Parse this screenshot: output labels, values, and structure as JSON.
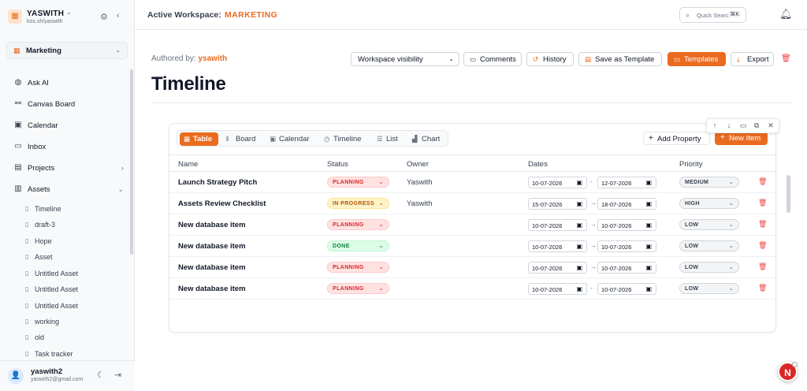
{
  "sidebar": {
    "workspace_name": "YASWITH",
    "workspace_slug": "kos.sh/yaswith",
    "selected_workspace": "Marketing",
    "nav": [
      {
        "label": "Ask AI",
        "icon": "globe-icon"
      },
      {
        "label": "Canvas Board",
        "icon": "canvas-icon"
      },
      {
        "label": "Calendar",
        "icon": "calendar-icon"
      },
      {
        "label": "Inbox",
        "icon": "inbox-icon"
      },
      {
        "label": "Projects",
        "icon": "folder-icon"
      },
      {
        "label": "Assets",
        "icon": "book-icon"
      }
    ],
    "assets": [
      "Timeline",
      "draft-3",
      "Hope",
      "Asset",
      "Untitled Asset",
      "Untitled Asset",
      "Untitled Asset",
      "working",
      "old",
      "Task tracker"
    ],
    "user": {
      "name": "yaswith2",
      "email": "yaswith2@gmail.com"
    }
  },
  "topbar": {
    "label": "Active Workspace:",
    "workspace": "MARKETING",
    "search_placeholder": "Quick Search...",
    "search_shortcut": "⌘K"
  },
  "page": {
    "authored_label": "Authored by:",
    "author": "ysawith",
    "visibility": "Workspace visibility",
    "actions": {
      "comments": "Comments",
      "history": "History",
      "save_template": "Save as Template",
      "templates": "Templates",
      "export": "Export"
    },
    "title": "Timeline"
  },
  "database": {
    "views": [
      "Table",
      "Board",
      "Calendar",
      "Timeline",
      "List",
      "Chart"
    ],
    "active_view": "Table",
    "add_property": "Add Property",
    "new_item": "New Item",
    "columns": [
      "Name",
      "Status",
      "Owner",
      "Dates",
      "Priority"
    ],
    "rows": [
      {
        "name": "Launch Strategy Pitch",
        "status": "PLANNING",
        "owner": "Yaswith",
        "start": "10-07-2026",
        "end": "12-07-2026",
        "priority": "MEDIUM"
      },
      {
        "name": "Assets Review Checklist",
        "status": "IN PROGRESS",
        "owner": "Yaswith",
        "start": "15-07-2026",
        "end": "18-07-2026",
        "priority": "HIGH"
      },
      {
        "name": "New database item",
        "status": "PLANNING",
        "owner": "",
        "start": "10-07-2026",
        "end": "10-07-2026",
        "priority": "LOW"
      },
      {
        "name": "New database item",
        "status": "DONE",
        "owner": "",
        "start": "10-07-2026",
        "end": "10-07-2026",
        "priority": "LOW"
      },
      {
        "name": "New database item",
        "status": "PLANNING",
        "owner": "",
        "start": "10-07-2026",
        "end": "10-07-2026",
        "priority": "LOW"
      },
      {
        "name": "New database item",
        "status": "PLANNING",
        "owner": "",
        "start": "10-07-2026",
        "end": "10-07-2026",
        "priority": "LOW"
      }
    ]
  },
  "colors": {
    "accent": "#ea6b1f",
    "planning": "#dc2626",
    "in_progress": "#b45309",
    "done": "#15803d"
  },
  "fab_letter": "N"
}
